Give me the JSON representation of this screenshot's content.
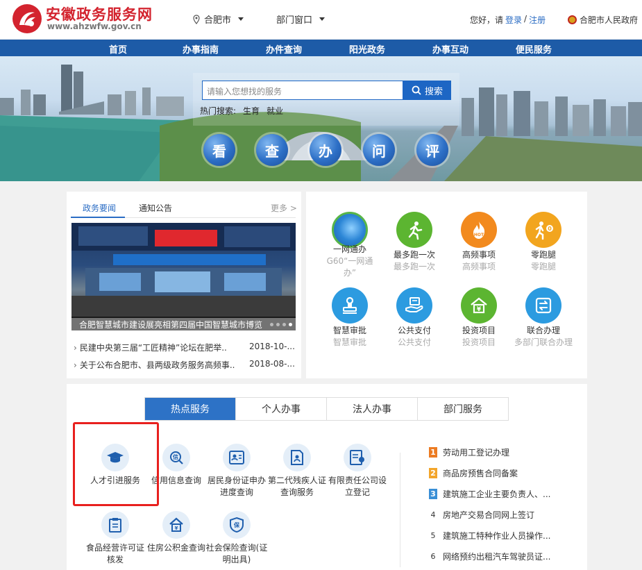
{
  "header": {
    "site_title": "安徽政务服务网",
    "site_url": "www.ahzwfw.gov.cn",
    "location": "合肥市",
    "department": "部门窗口",
    "greeting": "您好，请",
    "login": "登录",
    "separator": "/",
    "register": "注册",
    "gov_name": "合肥市人民政府"
  },
  "nav": {
    "items": [
      "首页",
      "办事指南",
      "办件查询",
      "阳光政务",
      "办事互动",
      "便民服务"
    ]
  },
  "search": {
    "placeholder": "请输入您想找的服务",
    "button": "搜索",
    "hot_label": "热门搜索:",
    "hot_terms": [
      "生育",
      "就业"
    ]
  },
  "banner_buttons": [
    "看",
    "查",
    "办",
    "问",
    "评"
  ],
  "news": {
    "tabs": [
      "政务要闻",
      "通知公告"
    ],
    "more": "更多 >",
    "caption": "合肥智慧城市建设展亮相第四届中国智慧城市博览",
    "items": [
      {
        "title": "民建中央第三届“工匠精神”论坛在肥举..",
        "date": "2018-10-..."
      },
      {
        "title": "关于公布合肥市、县两级政务服务高频事..",
        "date": "2018-08-..."
      }
    ]
  },
  "services": [
    {
      "name": "一网通办",
      "sub": "G60“一网通办”",
      "color": "#3a8fd6",
      "icon": "globe-icon"
    },
    {
      "name": "最多跑一次",
      "sub": "最多跑一次",
      "color": "#5cb531",
      "icon": "running-man-icon"
    },
    {
      "name": "高频事项",
      "sub": "高频事项",
      "color": "#f28a1e",
      "icon": "hot-fire-icon"
    },
    {
      "name": "零跑腿",
      "sub": "零跑腿",
      "color": "#f2a51e",
      "icon": "zero-run-icon"
    },
    {
      "name": "智慧审批",
      "sub": "智慧审批",
      "color": "#2c9be0",
      "icon": "stamp-icon"
    },
    {
      "name": "公共支付",
      "sub": "公共支付",
      "color": "#2c9be0",
      "icon": "payment-icon"
    },
    {
      "name": "投资项目",
      "sub": "投资项目",
      "color": "#5cb531",
      "icon": "investment-icon"
    },
    {
      "name": "联合办理",
      "sub": "多部门联合办理",
      "color": "#2c9be0",
      "icon": "joint-handling-icon"
    }
  ],
  "service_tabs": [
    "热点服务",
    "个人办事",
    "法人办事",
    "部门服务"
  ],
  "hot_services": [
    "人才引进服务",
    "信用信息查询",
    "居民身份证申办进度查询",
    "第二代残疾人证查询服务",
    "有限责任公司设立登记",
    "食品经营许可证核发",
    "住房公积金查询",
    "社会保险查询(证明出具)"
  ],
  "ranking": [
    {
      "n": "1",
      "title": "劳动用工登记办理"
    },
    {
      "n": "2",
      "title": "商品房预售合同备案"
    },
    {
      "n": "3",
      "title": "建筑施工企业主要负责人、..."
    },
    {
      "n": "4",
      "title": "房地产交易合同网上签订"
    },
    {
      "n": "5",
      "title": "建筑施工特种作业人员操作..."
    },
    {
      "n": "6",
      "title": "网络预约出租汽车驾驶员证..."
    }
  ],
  "colors": {
    "brand_red": "#d3232e",
    "nav_blue": "#1d5ba7",
    "link_blue": "#2a6cc4",
    "rank_1": "#ec7b22",
    "rank_2": "#f3a52a",
    "rank_3": "#3a8fd6",
    "highlight_box": "#e8201e"
  }
}
